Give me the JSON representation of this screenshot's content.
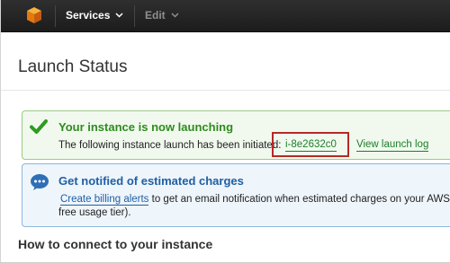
{
  "nav": {
    "services_label": "Services",
    "edit_label": "Edit",
    "logo_icon": "aws-cube-icon"
  },
  "page": {
    "title": "Launch Status"
  },
  "success": {
    "heading": "Your instance is now launching",
    "message": "The following instance launch has been initiated:",
    "instance_id": "i-8e2632c0",
    "log_link": "View launch log",
    "icon": "checkmark-icon",
    "color": "#2e8b1e"
  },
  "billing_notice": {
    "heading": "Get notified of estimated charges",
    "link": "Create billing alerts",
    "message_rest": " to get an email notification when estimated charges on your AWS",
    "message_line2": "free usage tier).",
    "icon": "chat-bubble-icon",
    "color": "#1f5fa4"
  },
  "connect": {
    "heading": "How to connect to your instance"
  },
  "colors": {
    "topbar": "#232323",
    "highlight": "#b52a25"
  }
}
